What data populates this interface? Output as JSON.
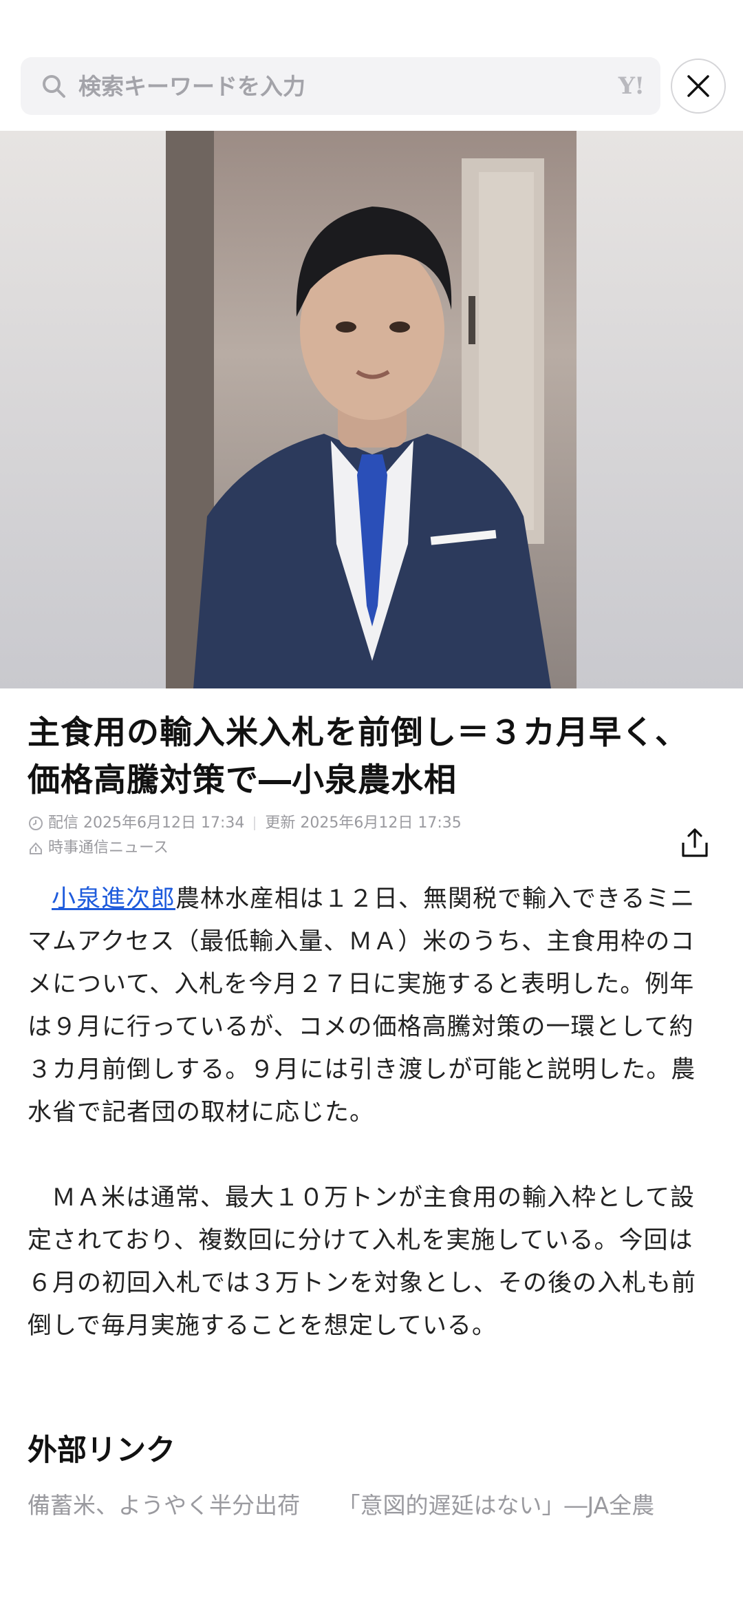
{
  "search": {
    "placeholder": "検索キーワードを入力",
    "logo": "Y!"
  },
  "photo": {
    "alt": ""
  },
  "article": {
    "title": "主食用の輸入米入札を前倒し＝３カ月早く、価格高騰対策で―小泉農水相",
    "published": "配信 2025年6月12日 17:34",
    "updated": "更新 2025年6月12日 17:35",
    "source": "時事通信ニュース",
    "person_link": "小泉進次郎",
    "paragraph1_rest": "農林水産相は１２日、無関税で輸入できるミニマムアクセス（最低輸入量、ＭＡ）米のうち、主食用枠のコメについて、入札を今月２７日に実施すると表明した。例年は９月に行っているが、コメの価格高騰対策の一環として約３カ月前倒しする。９月には引き渡しが可能と説明した。農水省で記者団の取材に応じた。",
    "paragraph2": "ＭＡ米は通常、最大１０万トンが主食用の輸入枠として設定されており、複数回に分けて入札を実施している。今回は６月の初回入札では３万トンを対象とし、その後の入札も前倒しで毎月実施することを想定している。"
  },
  "external": {
    "heading": "外部リンク",
    "links": [
      "備蓄米、ようやく半分出荷",
      "「意図的遅延はない」―JA全農"
    ]
  },
  "colors": {
    "link": "#1e5bdc",
    "meta": "#9a9a9f"
  }
}
